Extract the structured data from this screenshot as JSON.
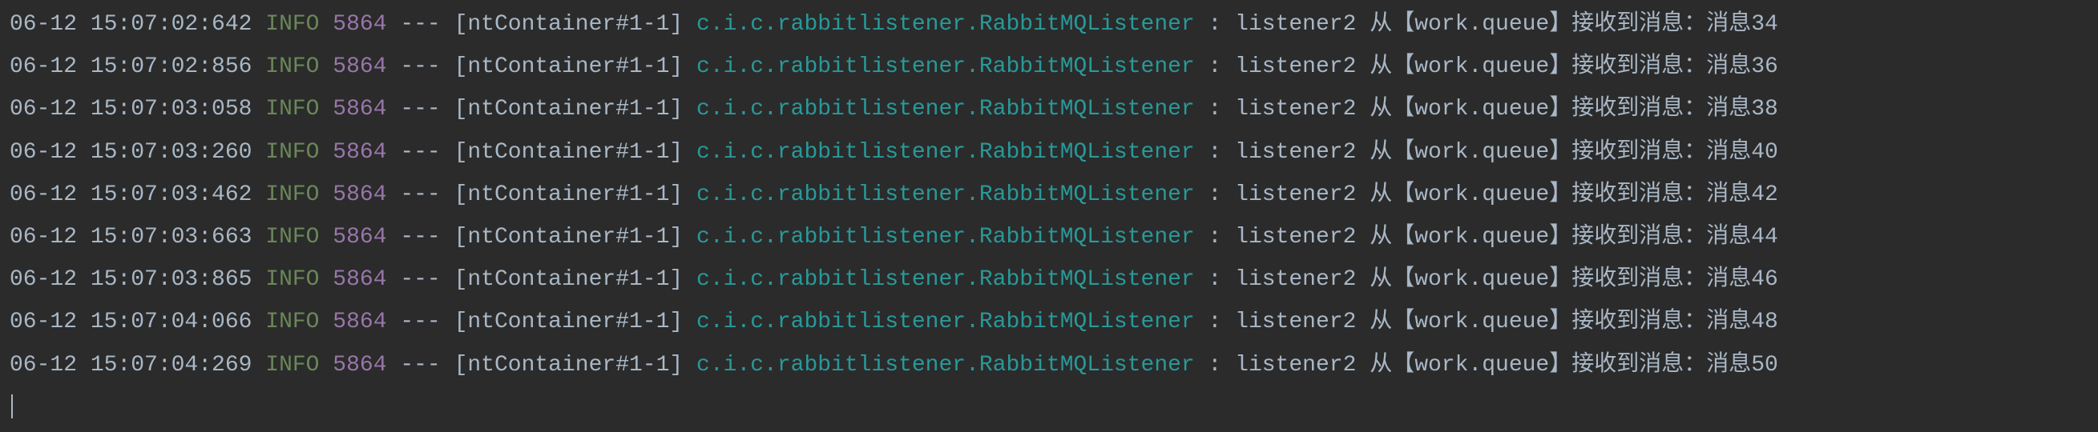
{
  "logs": [
    {
      "timestamp": "06-12 15:07:02:642",
      "level": "INFO",
      "pid": "5864",
      "dashes": "---",
      "thread": "[ntContainer#1-1]",
      "logger": "c.i.c.rabbitlistener.RabbitMQListener",
      "message": "listener2 从【work.queue】接收到消息：消息34"
    },
    {
      "timestamp": "06-12 15:07:02:856",
      "level": "INFO",
      "pid": "5864",
      "dashes": "---",
      "thread": "[ntContainer#1-1]",
      "logger": "c.i.c.rabbitlistener.RabbitMQListener",
      "message": "listener2 从【work.queue】接收到消息：消息36"
    },
    {
      "timestamp": "06-12 15:07:03:058",
      "level": "INFO",
      "pid": "5864",
      "dashes": "---",
      "thread": "[ntContainer#1-1]",
      "logger": "c.i.c.rabbitlistener.RabbitMQListener",
      "message": "listener2 从【work.queue】接收到消息：消息38"
    },
    {
      "timestamp": "06-12 15:07:03:260",
      "level": "INFO",
      "pid": "5864",
      "dashes": "---",
      "thread": "[ntContainer#1-1]",
      "logger": "c.i.c.rabbitlistener.RabbitMQListener",
      "message": "listener2 从【work.queue】接收到消息：消息40"
    },
    {
      "timestamp": "06-12 15:07:03:462",
      "level": "INFO",
      "pid": "5864",
      "dashes": "---",
      "thread": "[ntContainer#1-1]",
      "logger": "c.i.c.rabbitlistener.RabbitMQListener",
      "message": "listener2 从【work.queue】接收到消息：消息42"
    },
    {
      "timestamp": "06-12 15:07:03:663",
      "level": "INFO",
      "pid": "5864",
      "dashes": "---",
      "thread": "[ntContainer#1-1]",
      "logger": "c.i.c.rabbitlistener.RabbitMQListener",
      "message": "listener2 从【work.queue】接收到消息：消息44"
    },
    {
      "timestamp": "06-12 15:07:03:865",
      "level": "INFO",
      "pid": "5864",
      "dashes": "---",
      "thread": "[ntContainer#1-1]",
      "logger": "c.i.c.rabbitlistener.RabbitMQListener",
      "message": "listener2 从【work.queue】接收到消息：消息46"
    },
    {
      "timestamp": "06-12 15:07:04:066",
      "level": "INFO",
      "pid": "5864",
      "dashes": "---",
      "thread": "[ntContainer#1-1]",
      "logger": "c.i.c.rabbitlistener.RabbitMQListener",
      "message": "listener2 从【work.queue】接收到消息：消息48"
    },
    {
      "timestamp": "06-12 15:07:04:269",
      "level": "INFO",
      "pid": "5864",
      "dashes": "---",
      "thread": "[ntContainer#1-1]",
      "logger": "c.i.c.rabbitlistener.RabbitMQListener",
      "message": "listener2 从【work.queue】接收到消息：消息50"
    }
  ]
}
